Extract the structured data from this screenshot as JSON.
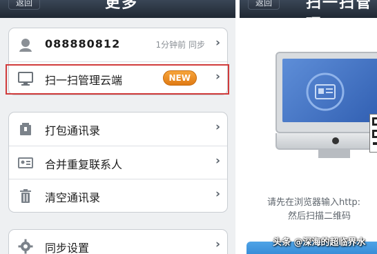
{
  "left": {
    "nav": {
      "back_label": "返回",
      "title": "更多"
    },
    "group1": [
      {
        "label": "088880812",
        "meta": "1分钟前 同步",
        "icon": "contact-icon"
      },
      {
        "label": "扫一扫管理云端",
        "badge": "NEW",
        "icon": "monitor-icon"
      }
    ],
    "group2": [
      {
        "label": "打包通讯录",
        "icon": "package-icon"
      },
      {
        "label": "合并重复联系人",
        "icon": "merge-card-icon"
      },
      {
        "label": "清空通讯录",
        "icon": "trash-icon"
      }
    ],
    "group3": [
      {
        "label": "同步设置",
        "icon": "gear-icon"
      }
    ]
  },
  "right": {
    "nav": {
      "back_label": "返回",
      "title": "扫一扫管理"
    },
    "instruction_1": "请先在浏览器输入http:",
    "instruction_2": "然后扫描二维码"
  },
  "watermark": "头条 @深海的超临界水",
  "colors": {
    "nav": "#2a3340",
    "highlight": "#d03a3a",
    "badge": "#e07b14",
    "accent": "#2a7fcf"
  }
}
